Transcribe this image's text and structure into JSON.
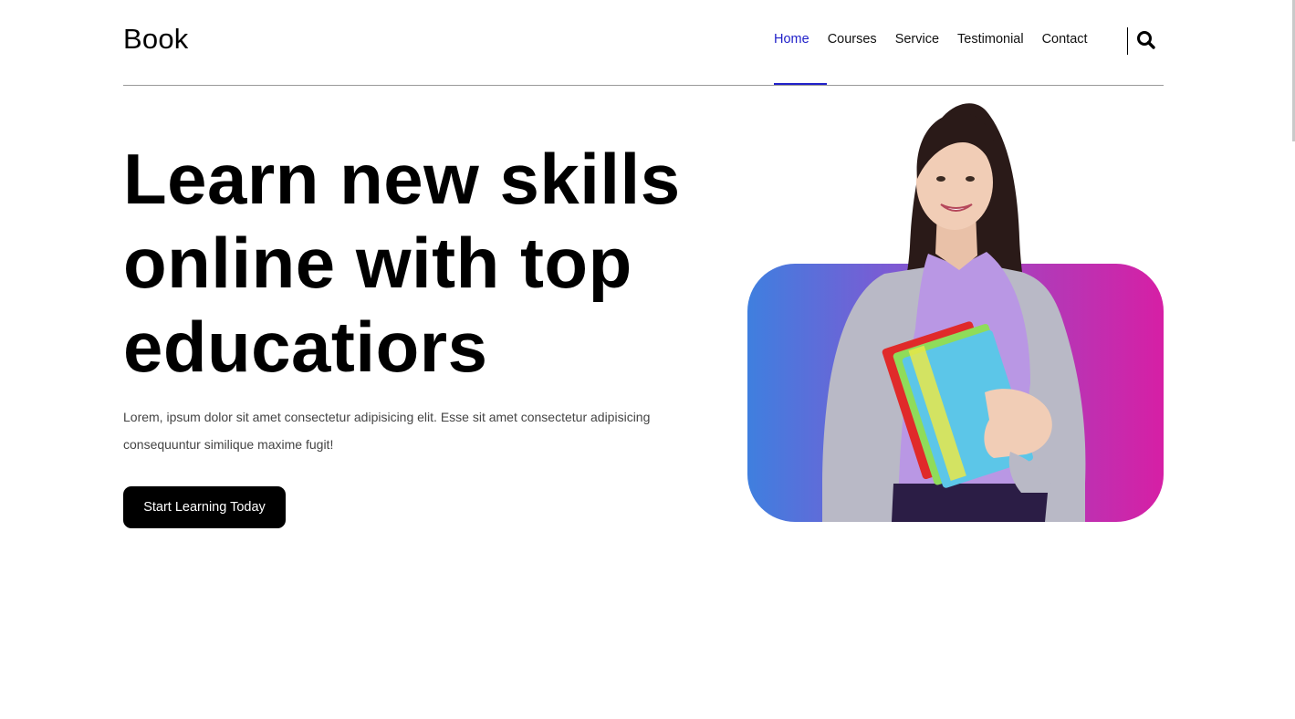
{
  "header": {
    "logo": "Book",
    "nav": [
      {
        "label": "Home",
        "active": true
      },
      {
        "label": "Courses",
        "active": false
      },
      {
        "label": "Service",
        "active": false
      },
      {
        "label": "Testimonial",
        "active": false
      },
      {
        "label": "Contact",
        "active": false
      }
    ],
    "search_icon": "search-icon"
  },
  "hero": {
    "headline_lines": [
      "Learn new skills",
      "online with top",
      "educatiors"
    ],
    "description": "Lorem, ipsum dolor sit amet consectetur adipisicing elit. Esse sit amet consectetur adipisicing consequuntur similique maxime fugit!",
    "cta_label": "Start Learning Today"
  },
  "colors": {
    "accent": "#2121c9",
    "button_bg": "#000000",
    "gradient_start": "#3f7fdf",
    "gradient_end": "#d61fa5"
  }
}
